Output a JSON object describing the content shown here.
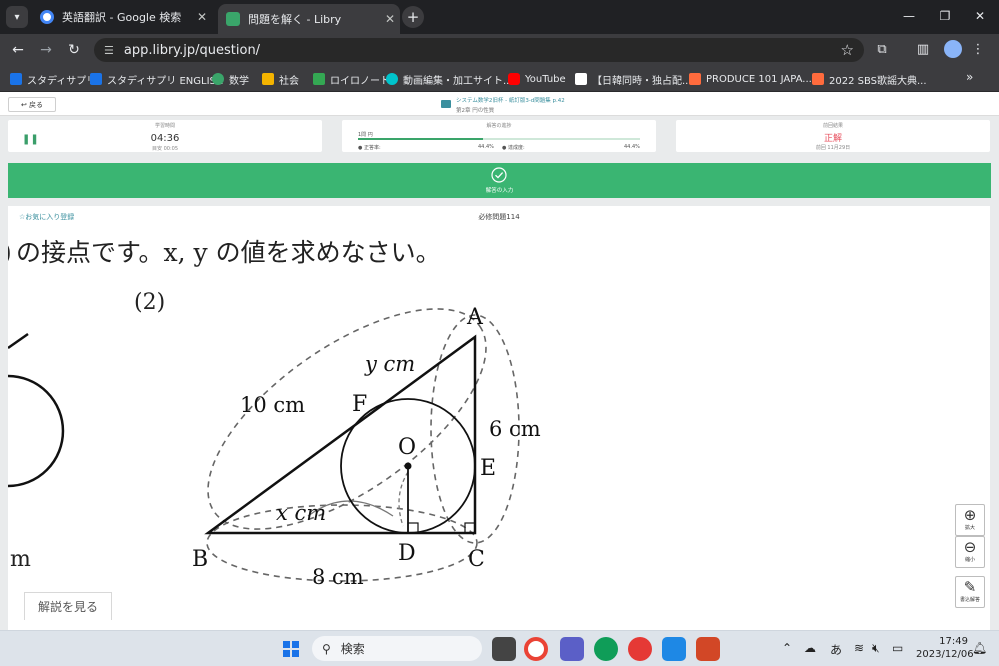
{
  "browser": {
    "tabs": [
      {
        "title": "英語翻訳 - Google 検索",
        "active": false
      },
      {
        "title": "問題を解く - Libry",
        "active": true
      }
    ],
    "url": "app.libry.jp/question/",
    "bookmarks": [
      "スタディサプリ",
      "スタディサプリ ENGLISH",
      "数学",
      "社会",
      "ロイロノート",
      "動画編集・加工サイト...",
      "YouTube",
      "【日韓同時・独占配...",
      "PRODUCE 101 JAPA...",
      "2022 SBS歌謡大典..."
    ],
    "bookmark_more": "»"
  },
  "header": {
    "back_label": "戻る",
    "book_title": "システム数学2旧杯 - 紙訂版3-d問題集 p.42",
    "chapter": "第2章 円の性質"
  },
  "timer": {
    "label": "学習時間",
    "value": "04:36",
    "sub": "目安 00:05"
  },
  "progress": {
    "label": "解答の進捗",
    "question": "1問 円",
    "fill": 0.444,
    "left_label": "● 正答率:",
    "left_value": "44.4%",
    "right_label": "● 達成度:",
    "right_value": "44.4%"
  },
  "previous": {
    "label": "前回結果",
    "result": "正解",
    "sub": "前回 11月29日"
  },
  "answer_bar": {
    "label": "解答の入力"
  },
  "content": {
    "favorite": "☆お気に入り登録",
    "problem_no": "必修問題114",
    "problem_text": "の接点です。x, y の値を求めなさい。",
    "partial_paren": ")",
    "part": "(2)",
    "left_m": "m",
    "figure": {
      "A": "A",
      "B": "B",
      "C": "C",
      "D": "D",
      "E": "E",
      "F": "F",
      "O": "O",
      "len_BF": "10 cm",
      "len_AF": "y cm",
      "len_AC": "6 cm",
      "len_BD": "x cm",
      "len_BC": "8 cm"
    }
  },
  "solution_tab": "解説を見る",
  "zoom": {
    "in": "拡大",
    "out": "縮小",
    "notes": "書込解答"
  },
  "taskbar": {
    "search": "検索",
    "time": "17:49",
    "date": "2023/12/06",
    "ime": "あ"
  }
}
